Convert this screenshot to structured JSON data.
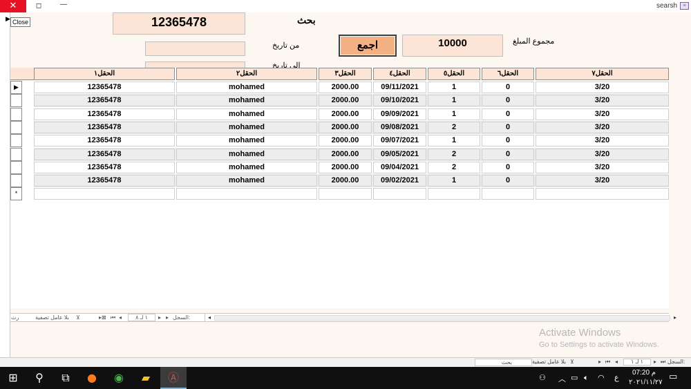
{
  "window": {
    "title": "searsh",
    "close_glyph": "✕",
    "restore_glyph": "◻",
    "minimize_glyph": "—",
    "close_tooltip": "Close",
    "app_icon": "form-view-icon"
  },
  "form": {
    "search_label": "بحث",
    "search_value": "12365478",
    "date_from_label": "من تاريخ",
    "date_to_label": "الي تاريخ",
    "sum_button": "اجمع",
    "total_value": "10000",
    "total_label": "مجموع المبلغ"
  },
  "datasheet": {
    "columns": [
      "الحقل١",
      "الحقل٢",
      "الحقل٣",
      "الحقل٤",
      "الحقل٥",
      "الحقل٦",
      "الحقل٧"
    ],
    "rows": [
      [
        "12365478",
        "mohamed",
        "2000.00",
        "09/11/2021",
        "1",
        "0",
        "3/20"
      ],
      [
        "12365478",
        "mohamed",
        "2000.00",
        "09/10/2021",
        "1",
        "0",
        "3/20"
      ],
      [
        "12365478",
        "mohamed",
        "2000.00",
        "09/09/2021",
        "1",
        "0",
        "3/20"
      ],
      [
        "12365478",
        "mohamed",
        "2000.00",
        "09/08/2021",
        "2",
        "0",
        "3/20"
      ],
      [
        "12365478",
        "mohamed",
        "2000.00",
        "09/07/2021",
        "1",
        "0",
        "3/20"
      ],
      [
        "12365478",
        "mohamed",
        "2000.00",
        "09/05/2021",
        "2",
        "0",
        "3/20"
      ],
      [
        "12365478",
        "mohamed",
        "2000.00",
        "09/04/2021",
        "2",
        "0",
        "3/20"
      ],
      [
        "12365478",
        "mohamed",
        "2000.00",
        "09/02/2021",
        "1",
        "0",
        "3/20"
      ]
    ],
    "current_row_marker": "▶",
    "new_row_marker": "*",
    "nav": {
      "record_label": "السجل:",
      "position": "١ لـ ٨",
      "no_filter": "بلا عامل تصفية",
      "search_abbrev": "ﺭﺙ"
    }
  },
  "form_nav": {
    "record_label": "السجل:",
    "position": "١ لـ ١",
    "no_filter": "بلا عامل تصفية",
    "search": "بحث"
  },
  "watermark": {
    "line1": "Activate Windows",
    "line2": "Go to Settings to activate Windows."
  },
  "taskbar": {
    "apps": [
      "windows-start-icon",
      "search-icon",
      "task-view-icon",
      "firefox-icon",
      "chrome-icon",
      "file-explorer-icon",
      "access-icon"
    ],
    "active_app": "access-icon",
    "lang": "ع",
    "time": "07:20 م",
    "date": "٢٠٢١/١١/٢٧"
  },
  "colors": {
    "accent_beige": "#fce4d6",
    "button_orange": "#f4b183",
    "close_red": "#e81123",
    "taskbar": "#101010"
  }
}
